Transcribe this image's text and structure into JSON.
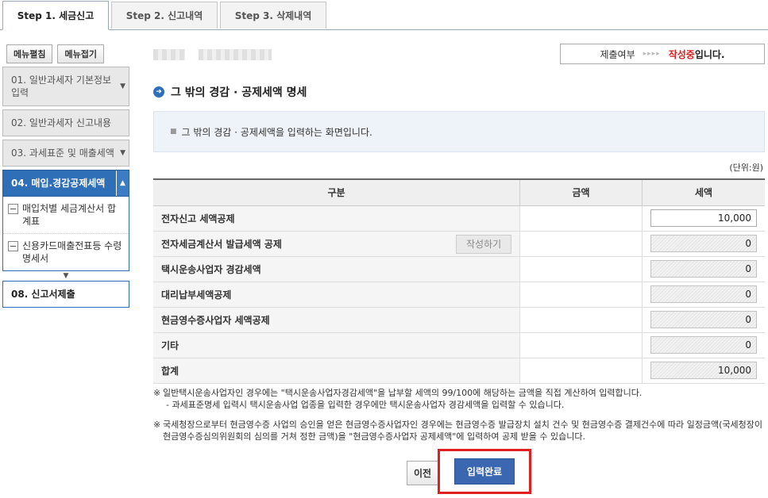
{
  "tabs": [
    {
      "label": "Step 1. 세금신고",
      "active": true
    },
    {
      "label": "Step 2. 신고내역",
      "active": false
    },
    {
      "label": "Step 3. 삭제내역",
      "active": false
    }
  ],
  "sidebar": {
    "expand_label": "메뉴펼침",
    "collapse_label": "메뉴접기",
    "items": [
      {
        "label": "01. 일반과세자 기본정보입력"
      },
      {
        "label": "02. 일반과세자 신고내용"
      },
      {
        "label": "03. 과세표준 및 매출세액"
      },
      {
        "label": "04. 매입.경감공제세액"
      }
    ],
    "sub_items": [
      {
        "label": "매입처별 세금계산서 합계표"
      },
      {
        "label": "신용카드매출전표등 수령명세서"
      }
    ],
    "final_item": "08. 신고서제출"
  },
  "status": {
    "label": "제출여부",
    "arrows": "▸▸▸▸",
    "state": "작성중",
    "suffix": "입니다."
  },
  "section": {
    "title": "그 밖의 경감 · 공제세액 명세",
    "info": "그 밖의 경감 · 공제세액을 입력하는 화면입니다.",
    "unit": "(단위:원)"
  },
  "table": {
    "headers": [
      "구분",
      "금액",
      "세액"
    ],
    "write_button": "작성하기",
    "rows": [
      {
        "label": "전자신고 세액공제",
        "amount": "",
        "tax": "10,000",
        "readonly": false
      },
      {
        "label": "전자세금계산서 발급세액 공제",
        "amount": "",
        "tax": "0",
        "readonly": true
      },
      {
        "label": "택시운송사업자 경감세액",
        "amount": "",
        "tax": "0",
        "readonly": true
      },
      {
        "label": "대리납부세액공제",
        "amount": "",
        "tax": "0",
        "readonly": true
      },
      {
        "label": "현금영수증사업자 세액공제",
        "amount": "",
        "tax": "0",
        "readonly": true
      },
      {
        "label": "기타",
        "amount": "",
        "tax": "0",
        "readonly": true
      },
      {
        "label": "합계",
        "amount": "",
        "tax": "10,000",
        "readonly": true
      }
    ]
  },
  "notes": {
    "note1": "일반택시운송사업자인 경우에는 \"택시운송사업자경감세액\"을 납부할 세액의 99/100에 해당하는 금액을 직접 계산하여 입력합니다.",
    "note1_sub": "- 과세표준명세 입력시 택시운송사업 업종을 입력한 경우에만 택시운송사업자 경감세액을 입력할 수 있습니다.",
    "note2": "국세청장으로부터 현금영수증 사업의 승인을 얻은 현금영수증사업자인 경우에는 현금영수증 발급장치 설치 건수 및 현금영수증 결제건수에 따라 일정금액(국세청장이 현금영수증심의위원회의 심의를 거쳐 정한 금액)을 \"현금영수증사업자 공제세액\"에 입력하여 공제 받을 수 있습니다.",
    "mark": "※"
  },
  "buttons": {
    "prev": "이전",
    "done": "입력완료"
  }
}
